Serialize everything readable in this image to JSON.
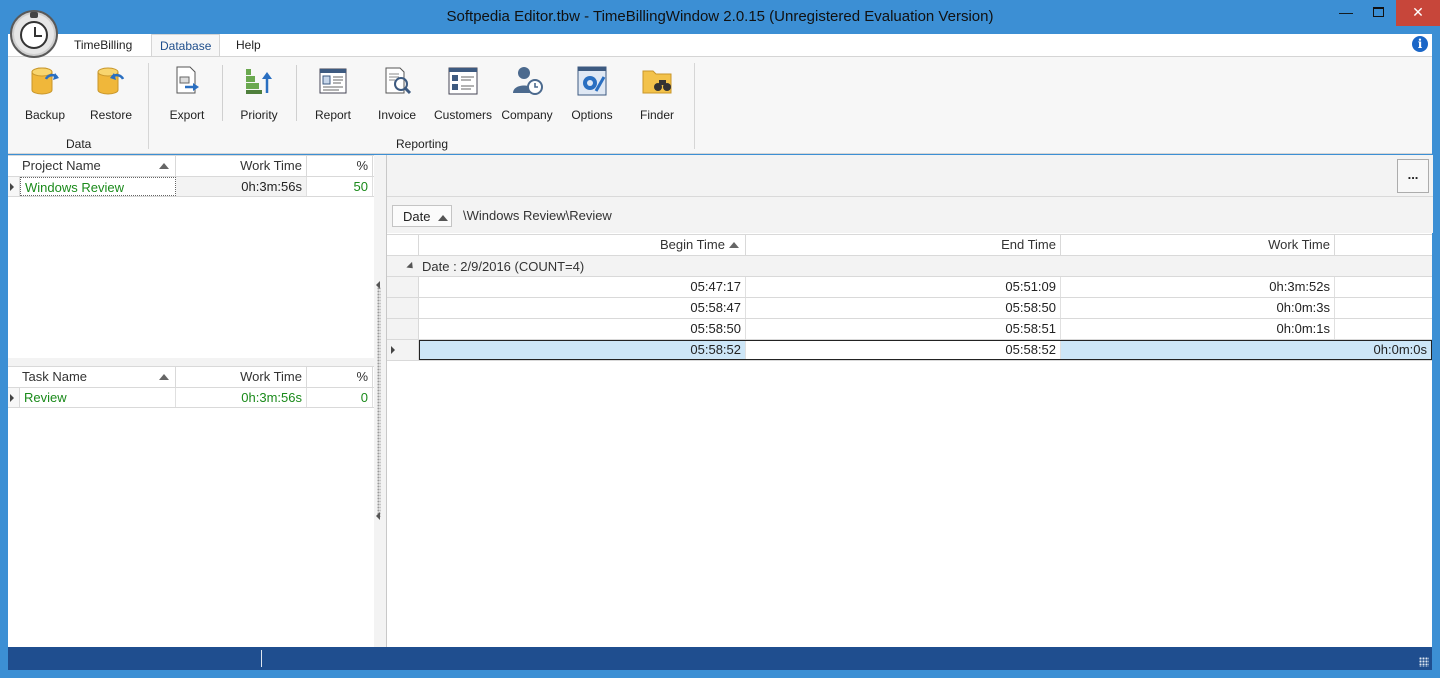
{
  "window": {
    "title": "Softpedia Editor.tbw - TimeBillingWindow 2.0.15 (Unregistered Evaluation Version)",
    "minimize": "—",
    "close": "✕"
  },
  "menu": {
    "items": [
      "TimeBilling",
      "Database",
      "Help"
    ],
    "info": "i"
  },
  "ribbon": {
    "buttons": [
      {
        "label": "Backup",
        "icon": "database-backup-icon"
      },
      {
        "label": "Restore",
        "icon": "database-restore-icon"
      },
      {
        "label": "Export",
        "icon": "export-icon"
      },
      {
        "label": "Priority",
        "icon": "priority-icon"
      },
      {
        "label": "Report",
        "icon": "report-icon"
      },
      {
        "label": "Invoice",
        "icon": "invoice-icon"
      },
      {
        "label": "Customers",
        "icon": "customers-icon"
      },
      {
        "label": "Company",
        "icon": "company-icon"
      },
      {
        "label": "Options",
        "icon": "options-icon"
      },
      {
        "label": "Finder",
        "icon": "finder-icon"
      }
    ],
    "groups": [
      "Data",
      "Reporting"
    ]
  },
  "projects": {
    "columns": [
      "Project Name",
      "Work Time",
      "%"
    ],
    "rows": [
      {
        "name": "Windows Review",
        "work_time": "0h:3m:56s",
        "percent": "50"
      }
    ]
  },
  "tasks": {
    "columns": [
      "Task Name",
      "Work Time",
      "%"
    ],
    "rows": [
      {
        "name": "Review",
        "work_time": "0h:3m:56s",
        "percent": "0"
      }
    ]
  },
  "detail": {
    "more_button": "...",
    "group_chip": "Date",
    "path": "\\Windows Review\\Review",
    "columns": [
      "Begin Time",
      "End Time",
      "Work Time"
    ],
    "group_label": "Date : 2/9/2016 (COUNT=4)",
    "rows": [
      {
        "begin": "05:47:17",
        "end": "05:51:09",
        "work": "0h:3m:52s"
      },
      {
        "begin": "05:58:47",
        "end": "05:58:50",
        "work": "0h:0m:3s"
      },
      {
        "begin": "05:58:50",
        "end": "05:58:51",
        "work": "0h:0m:1s"
      },
      {
        "begin": "05:58:52",
        "end": "05:58:52",
        "work": "0h:0m:0s"
      }
    ]
  },
  "colors": {
    "title_bar": "#3c8fd4",
    "status_bar": "#1f4e8f",
    "selection": "#cde6f7",
    "green_text": "#1a8a1a"
  }
}
